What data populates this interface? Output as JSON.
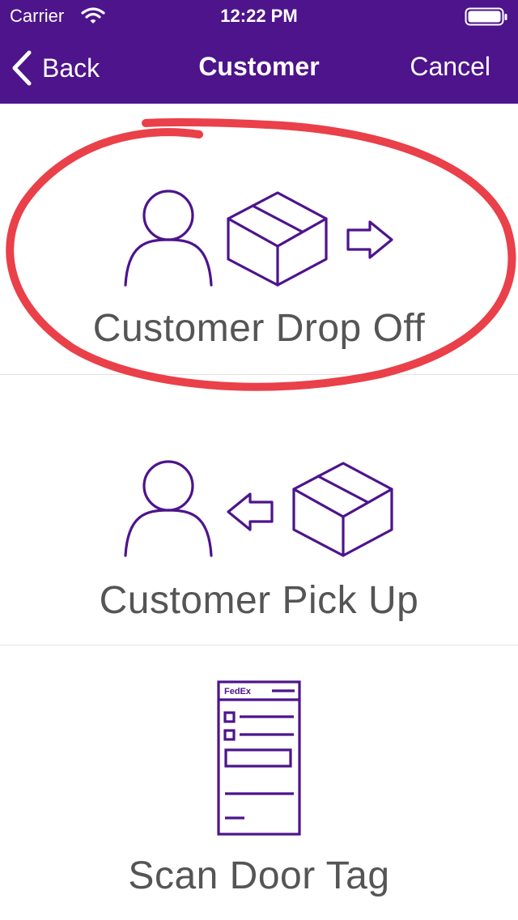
{
  "status_bar": {
    "carrier": "Carrier",
    "time": "12:22 PM"
  },
  "nav_bar": {
    "back_label": "Back",
    "title": "Customer",
    "cancel_label": "Cancel",
    "background_color": "#4d148c"
  },
  "options": [
    {
      "label": "Customer Drop Off",
      "icon": "person-box-arrow-right-icon",
      "highlighted": true
    },
    {
      "label": "Customer Pick Up",
      "icon": "person-arrow-left-box-icon",
      "highlighted": false
    },
    {
      "label": "Scan Door Tag",
      "icon": "fedex-door-tag-icon",
      "highlighted": false
    }
  ],
  "door_tag_icon": {
    "logo_text": "FedEx"
  },
  "colors": {
    "accent_purple": "#4d148c",
    "label_gray": "#555555",
    "highlight_red": "#e8303a"
  }
}
